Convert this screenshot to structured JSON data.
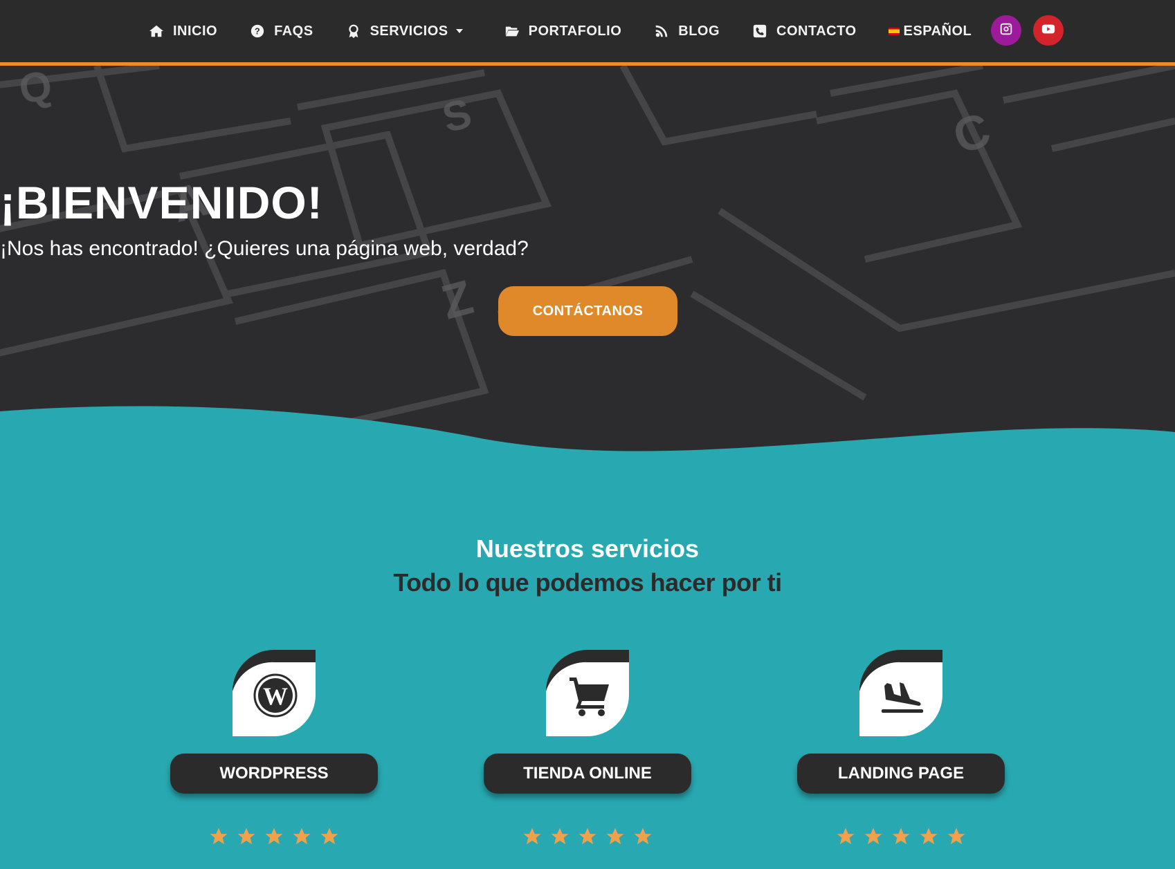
{
  "nav": {
    "items": [
      {
        "label": "INICIO",
        "icon": "home-icon"
      },
      {
        "label": "FAQS",
        "icon": "question-circle-icon"
      },
      {
        "label": "SERVICIOS",
        "icon": "award-icon"
      },
      {
        "label": "PORTAFOLIO",
        "icon": "folder-open-icon"
      },
      {
        "label": "BLOG",
        "icon": "rss-icon"
      },
      {
        "label": "CONTACTO",
        "icon": "phone-square-icon"
      },
      {
        "label": "ESPAÑOL",
        "icon": "spain-flag-icon"
      }
    ],
    "social": [
      {
        "icon": "instagram-icon",
        "color": "#9d1b9a"
      },
      {
        "icon": "youtube-icon",
        "color": "#d3232b"
      }
    ]
  },
  "hero": {
    "title": "¡BIENVENIDO!",
    "subtitle": "¡Nos has encontrado! ¿Quieres una página web, verdad?",
    "cta_label": "CONTÁCTANOS"
  },
  "services": {
    "title": "Nuestros servicios",
    "subtitle": "Todo lo que podemos hacer por ti",
    "cards": [
      {
        "label": "WORDPRESS",
        "icon": "wordpress-icon",
        "rating": 5
      },
      {
        "label": "TIENDA ONLINE",
        "icon": "shopping-cart-icon",
        "rating": 5
      },
      {
        "label": "LANDING PAGE",
        "icon": "plane-landing-icon",
        "rating": 5
      }
    ]
  },
  "colors": {
    "nav_bg": "#2b2b2c",
    "accent_orange": "#e0892a",
    "teal": "#28a8b0",
    "star": "#f0a14c"
  }
}
